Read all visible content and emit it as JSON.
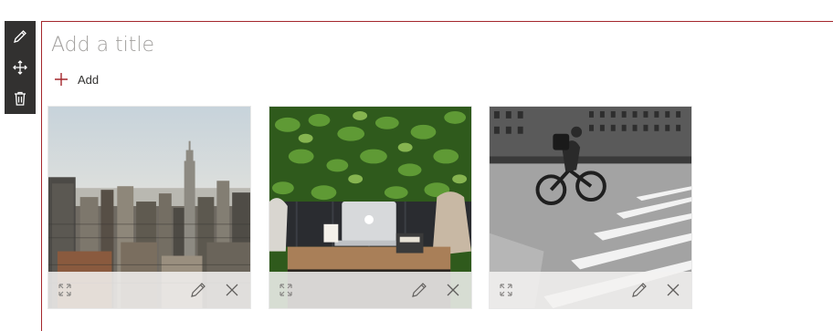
{
  "toolbar": {
    "items": [
      {
        "icon": "pencil-icon"
      },
      {
        "icon": "move-icon"
      },
      {
        "icon": "trash-icon"
      }
    ]
  },
  "section": {
    "title_placeholder": "Add a title",
    "add_label": "Add",
    "accent_color": "#a4262c"
  },
  "tiles": [
    {
      "image": "city-skyline-photo"
    },
    {
      "image": "cafe-laptop-photo"
    },
    {
      "image": "cyclist-crosswalk-photo"
    }
  ]
}
